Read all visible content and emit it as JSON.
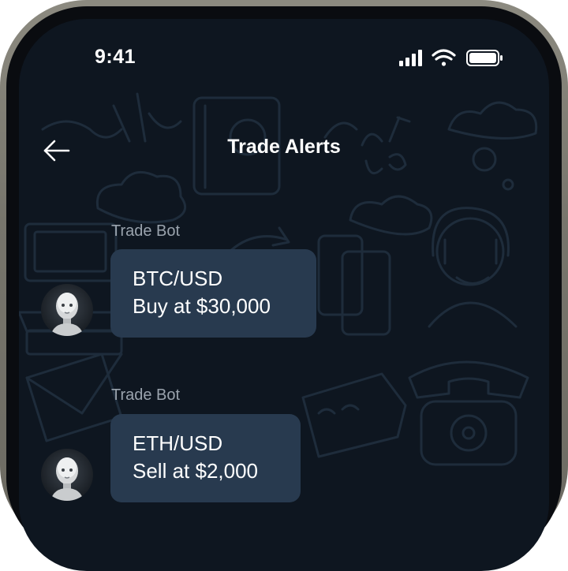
{
  "status_bar": {
    "time": "9:41"
  },
  "header": {
    "title": "Trade Alerts",
    "back_icon": "arrow-left-icon"
  },
  "messages": [
    {
      "sender": "Trade Bot",
      "pair": "BTC/USD",
      "action": "Buy at $30,000",
      "avatar": "robot-avatar"
    },
    {
      "sender": "Trade Bot",
      "pair": "ETH/USD",
      "action": "Sell at $2,000",
      "avatar": "robot-avatar"
    }
  ],
  "colors": {
    "background": "#0e1620",
    "bubble": "#283a4f",
    "sender_text": "#9aa3ad",
    "text": "#ffffff"
  }
}
